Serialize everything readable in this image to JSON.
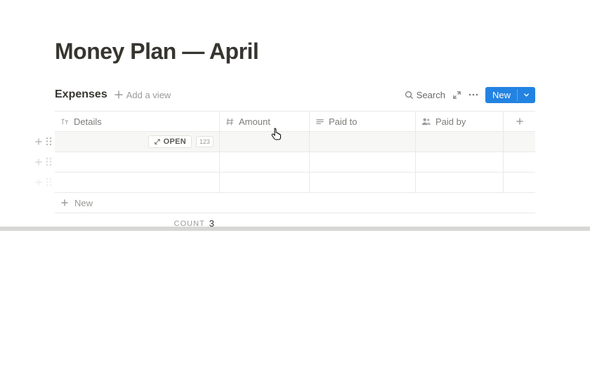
{
  "page": {
    "title": "Money Plan — April"
  },
  "db": {
    "name": "Expenses",
    "add_view_label": "Add a view",
    "search_label": "Search",
    "new_button_label": "New",
    "columns": {
      "details": "Details",
      "amount": "Amount",
      "paid_to": "Paid to",
      "paid_by": "Paid by"
    },
    "open_pill": "OPEN",
    "hint123": "123",
    "new_row_label": "New",
    "count_label": "COUNT",
    "count_value": "3"
  }
}
